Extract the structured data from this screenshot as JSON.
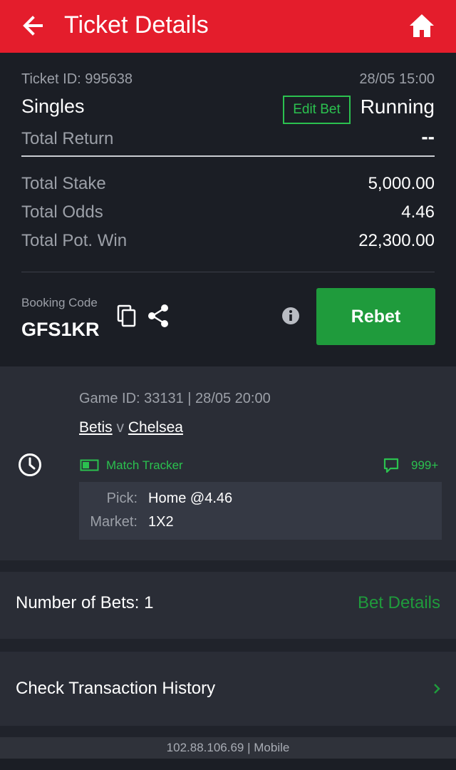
{
  "header": {
    "title": "Ticket Details",
    "back_icon": "arrow-left-icon",
    "home_icon": "home-icon"
  },
  "ticket": {
    "id_label": "Ticket ID: 995638",
    "datetime": "28/05 15:00",
    "bet_type": "Singles",
    "edit_bet_label": "Edit Bet",
    "status": "Running",
    "total_return_label": "Total Return",
    "total_return_value": "--",
    "total_stake_label": "Total Stake",
    "total_stake_value": "5,000.00",
    "total_odds_label": "Total Odds",
    "total_odds_value": "4.46",
    "total_pot_win_label": "Total Pot. Win",
    "total_pot_win_value": "22,300.00"
  },
  "booking": {
    "label": "Booking Code",
    "code": "GFS1KR",
    "rebet_label": "Rebet"
  },
  "selection": {
    "game_info": "Game ID: 33131 | 28/05 20:00",
    "home_team": "Betis",
    "versus": "v",
    "away_team": "Chelsea",
    "match_tracker_label": "Match Tracker",
    "comments_count": "999+",
    "pick_label": "Pick:",
    "pick_value": "Home @4.46",
    "market_label": "Market:",
    "market_value": "1X2"
  },
  "bets_row": {
    "label": "Number of Bets: 1",
    "details_link": "Bet Details"
  },
  "transaction_row": {
    "label": "Check Transaction History"
  },
  "footer": {
    "text": "102.88.106.69 | Mobile"
  },
  "colors": {
    "brand_red": "#e41d2c",
    "accent_green": "#2bc14f",
    "button_green": "#1f9b3c",
    "panel_dark": "#1b1e25",
    "background": "#2a2d36"
  }
}
